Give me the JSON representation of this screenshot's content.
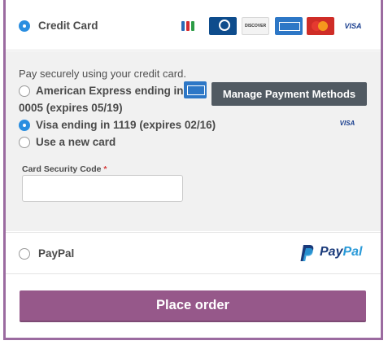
{
  "payment_methods": {
    "credit_card": {
      "label": "Credit Card",
      "selected": true,
      "card_icons": [
        "jcb-icon",
        "diners-club-icon",
        "discover-icon",
        "amex-icon",
        "mastercard-icon",
        "visa-icon"
      ],
      "discover_text": "DISCOVER",
      "visa_text": "VISA"
    },
    "paypal": {
      "label": "PayPal",
      "selected": false,
      "logo_pay": "Pay",
      "logo_pal": "Pal"
    }
  },
  "cc_panel": {
    "description": "Pay securely using your credit card.",
    "manage_button": "Manage Payment Methods",
    "saved_cards": [
      {
        "line1": "American Express ending in",
        "line2": "0005 (expires 05/19)",
        "selected": false,
        "icon": "amex-icon"
      },
      {
        "line1": "Visa ending in 1119 (expires 02/16)",
        "selected": true,
        "icon": "visa-icon",
        "icon_text": "VISA"
      },
      {
        "line1": "Use a new card",
        "selected": false
      }
    ],
    "csc_label": "Card Security Code",
    "csc_required_mark": "*",
    "csc_value": ""
  },
  "place_order_label": "Place order",
  "colors": {
    "accent": "#96588a",
    "radio_checked": "#2a8ee0",
    "manage_button_bg": "#515a62",
    "panel_bg": "#f1f1f1"
  }
}
